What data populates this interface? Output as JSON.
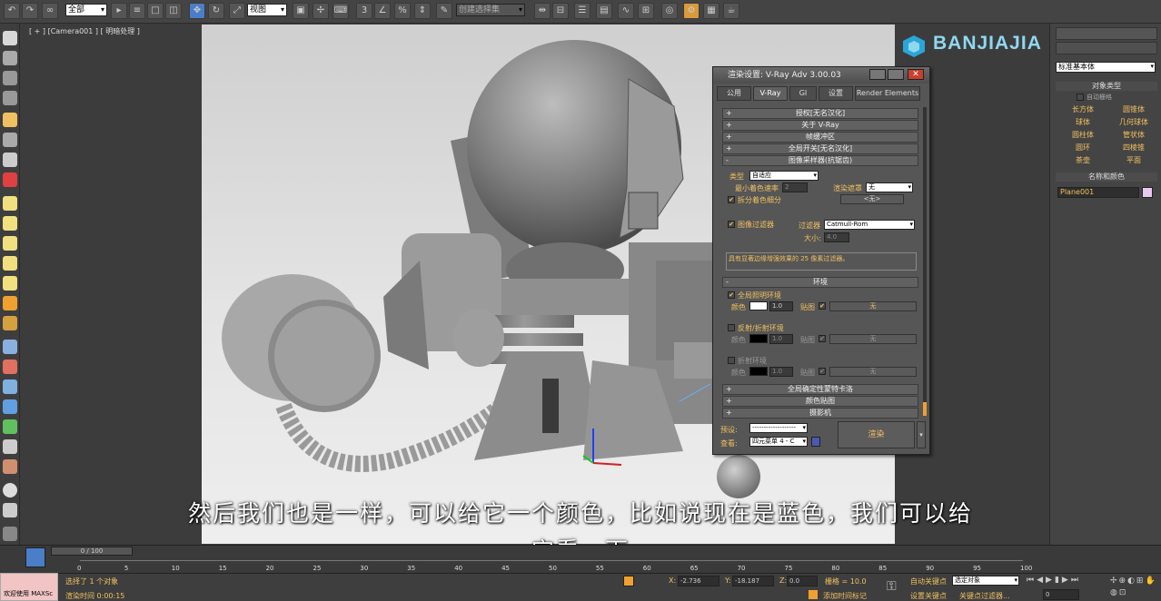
{
  "toolbar": {
    "selection_filter": "全部",
    "ref_coord": "视图",
    "named_selection": "创建选择集"
  },
  "viewport": {
    "label": "[ + ] [Camera001 ] [ 明暗处理 ]"
  },
  "watermark": {
    "text": "BANJIAJIA"
  },
  "command_panel": {
    "category": "标准基本体",
    "object_type_header": "对象类型",
    "autogrid": "自动栅格",
    "primitives": [
      "长方体",
      "圆锥体",
      "球体",
      "几何球体",
      "圆柱体",
      "管状体",
      "圆环",
      "四棱锥",
      "茶壶",
      "平面"
    ],
    "name_color_header": "名称和颜色",
    "object_name": "Plane001",
    "object_color": "#e8c8f0"
  },
  "dialog": {
    "title": "渲染设置: V-Ray Adv 3.00.03",
    "tabs": [
      "公用",
      "V-Ray",
      "GI",
      "设置",
      "Render Elements"
    ],
    "active_tab": "V-Ray",
    "rollouts_collapsed": [
      "授权[无名汉化]",
      "关于 V-Ray",
      "帧缓冲区",
      "全局开关[无名汉化]"
    ],
    "sampler_rollout": "图像采样器(抗锯齿)",
    "sampler": {
      "type_label": "类型",
      "type_value": "自适应",
      "min_shading_label": "最小着色速率",
      "min_shading_value": "2",
      "render_mask_label": "渲染遮罩",
      "render_mask_value": "无",
      "divide_shading_label": "拆分着色细分",
      "none_label": "<无>"
    },
    "filter": {
      "image_filter_label": "图像过滤器",
      "filter_label": "过滤器",
      "filter_value": "Catmull-Rom",
      "size_label": "大小:",
      "size_value": "4.0",
      "description": "具有显著边缘增强效果的 25 像素过滤器。"
    },
    "environment_rollout": "环境",
    "environment": {
      "gi_env_label": "全局照明环境",
      "color_label": "颜色",
      "multiplier_value": "1.0",
      "map_label": "贴图",
      "map_none": "无",
      "refl_env_label": "反射/折射环境",
      "refr_env_label": "折射环境",
      "refl_multiplier": "1.0",
      "refr_multiplier": "1.0"
    },
    "rollouts_bottom": [
      "全局确定性蒙特卡洛",
      "颜色贴图",
      "摄影机"
    ],
    "footer": {
      "preset_label": "预设:",
      "preset_value": "-------------------",
      "view_label": "查看:",
      "view_value": "四元菜单 4 - C",
      "render_button": "渲染"
    }
  },
  "subtitle": {
    "line1": "然后我们也是一样，可以给它一个颜色，比如说现在是蓝色，我们可以给",
    "line2": "它看一下"
  },
  "timeline": {
    "frame_display": "0 / 100",
    "ticks": [
      "0",
      "5",
      "10",
      "15",
      "20",
      "25",
      "30",
      "35",
      "40",
      "45",
      "50",
      "55",
      "60",
      "65",
      "70",
      "75",
      "80",
      "85",
      "90",
      "95",
      "100"
    ]
  },
  "status": {
    "maxscript": "欢迎使用 MAXSc",
    "selected": "选择了 1 个对象",
    "render_time": "渲染时间 0:00:15",
    "x_label": "X:",
    "x_value": "-2.736",
    "y_label": "Y:",
    "y_value": "-18.187",
    "z_label": "Z:",
    "z_value": "0.0",
    "grid": "栅格 = 10.0",
    "add_time_tag": "添加时间标记",
    "auto_key": "自动关键点",
    "set_key": "设置关键点",
    "selection_set": "选定对象",
    "key_filter": "关键点过滤器...",
    "frame_value": "0"
  }
}
